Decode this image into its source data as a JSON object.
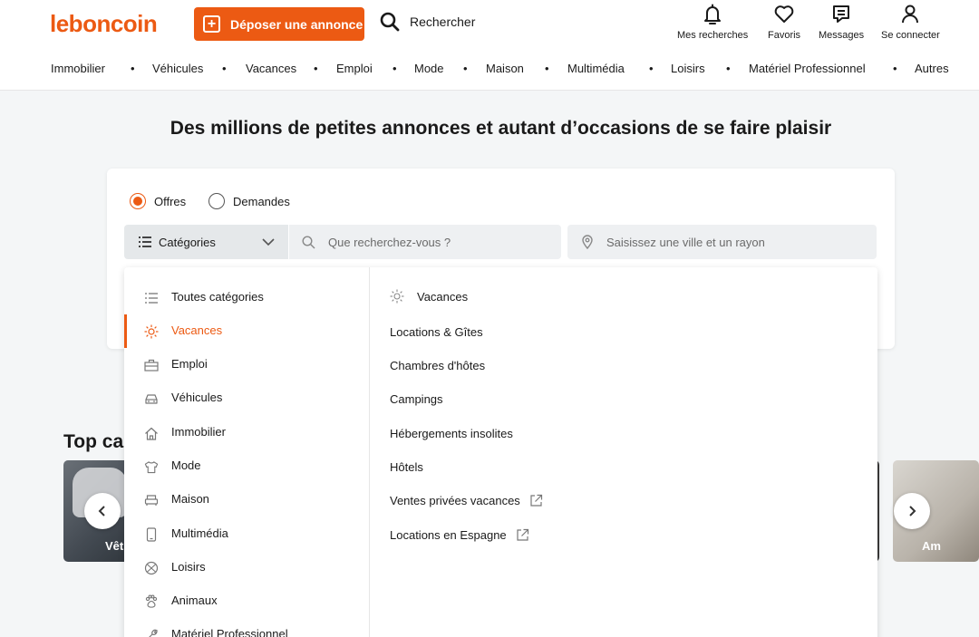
{
  "header": {
    "logo": "leboncoin",
    "post_button": "Déposer une annonce",
    "search_link": "Rechercher",
    "actions": [
      {
        "label": "Mes recherches",
        "icon": "bell-icon"
      },
      {
        "label": "Favoris",
        "icon": "heart-icon"
      },
      {
        "label": "Messages",
        "icon": "message-icon"
      },
      {
        "label": "Se connecter",
        "icon": "user-icon"
      }
    ]
  },
  "category_nav": [
    "Immobilier",
    "Véhicules",
    "Vacances",
    "Emploi",
    "Mode",
    "Maison",
    "Multimédia",
    "Loisirs",
    "Matériel Professionnel",
    "Autres"
  ],
  "hero_title": "Des millions de petites annonces et autant d’occasions de se faire plaisir",
  "search": {
    "radio_offers": "Offres",
    "radio_requests": "Demandes",
    "category_select": "Catégories",
    "query_placeholder": "Que recherchez-vous ?",
    "location_placeholder": "Saisissez une ville et un rayon"
  },
  "dropdown": {
    "left": [
      {
        "label": "Toutes catégories",
        "icon": "list-icon"
      },
      {
        "label": "Vacances",
        "icon": "sun-icon",
        "active": true
      },
      {
        "label": "Emploi",
        "icon": "briefcase-icon"
      },
      {
        "label": "Véhicules",
        "icon": "car-icon"
      },
      {
        "label": "Immobilier",
        "icon": "house-icon"
      },
      {
        "label": "Mode",
        "icon": "shirt-icon"
      },
      {
        "label": "Maison",
        "icon": "armchair-icon"
      },
      {
        "label": "Multimédia",
        "icon": "phone-icon"
      },
      {
        "label": "Loisirs",
        "icon": "ball-icon"
      },
      {
        "label": "Animaux",
        "icon": "paw-icon"
      },
      {
        "label": "Matériel Professionnel",
        "icon": "tool-icon"
      }
    ],
    "right_header": "Vacances",
    "right": [
      {
        "label": "Locations & Gîtes",
        "external": false
      },
      {
        "label": "Chambres d'hôtes",
        "external": false
      },
      {
        "label": "Campings",
        "external": false
      },
      {
        "label": "Hébergements insolites",
        "external": false
      },
      {
        "label": "Hôtels",
        "external": false
      },
      {
        "label": "Ventes privées vacances",
        "external": true
      },
      {
        "label": "Locations en Espagne",
        "external": true
      }
    ]
  },
  "top_categories": {
    "title": "Top ca",
    "left_tile_label": "Vêt",
    "right_tile_label": "Am"
  },
  "colors": {
    "accent": "#ec5a13",
    "background": "#f4f6f7"
  }
}
